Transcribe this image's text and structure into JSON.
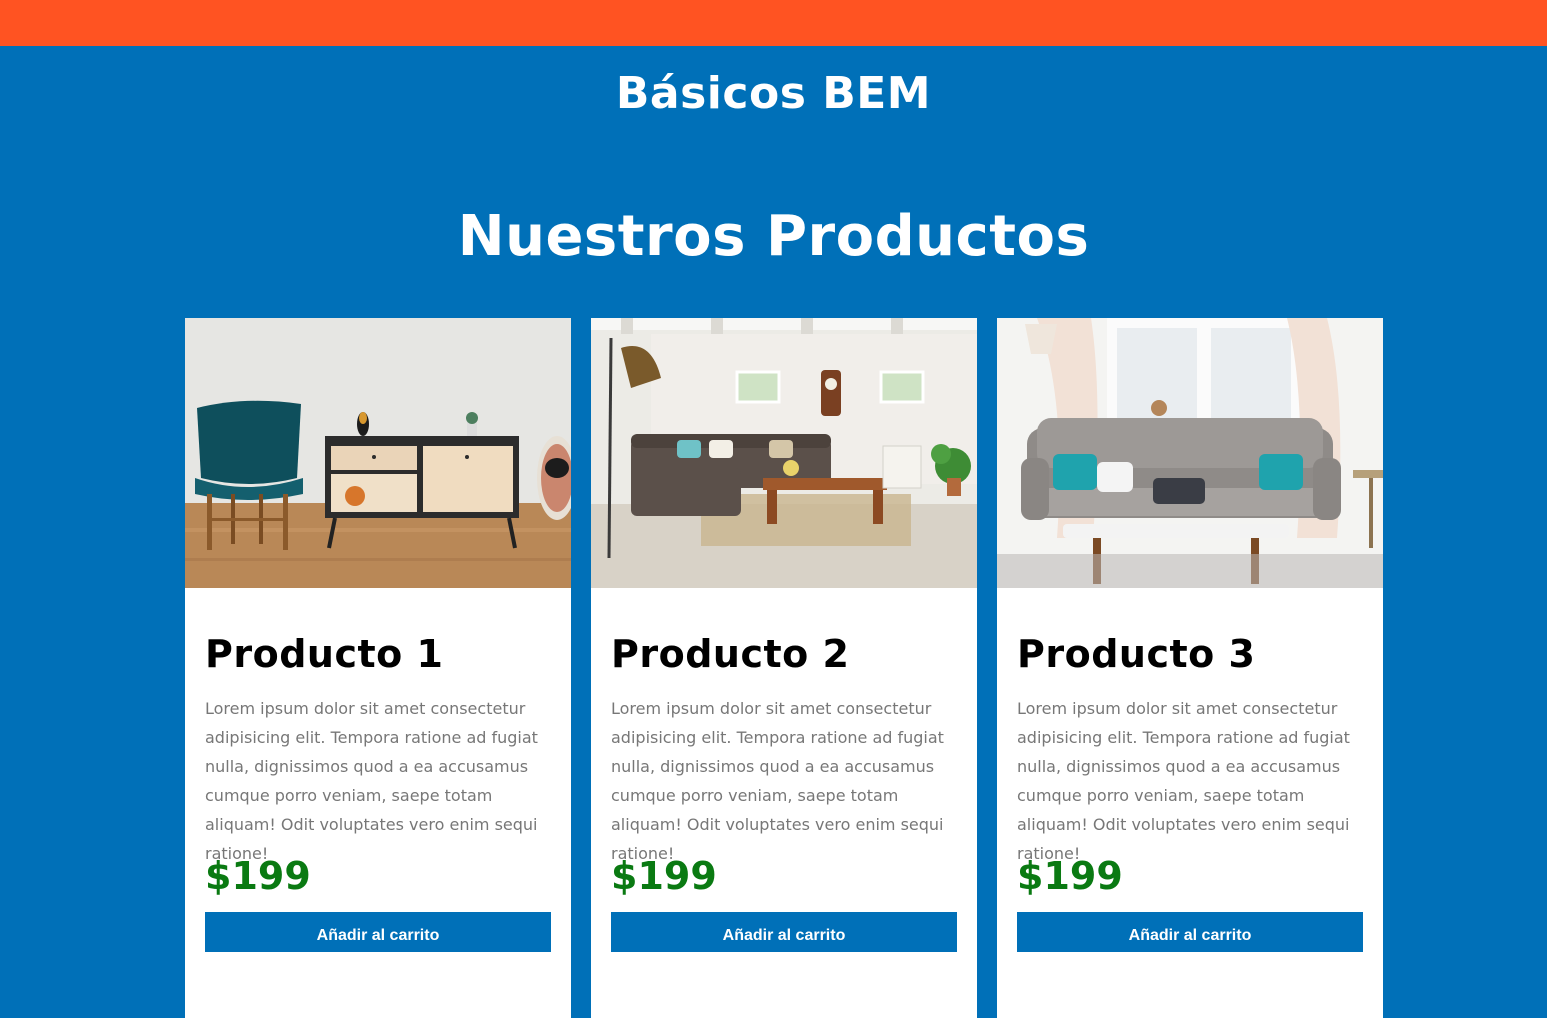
{
  "header": {
    "title": "Básicos BEM"
  },
  "section": {
    "title": "Nuestros Productos"
  },
  "colors": {
    "top_bar": "#ff5322",
    "background": "#0070b8",
    "price": "#0a7a12"
  },
  "products": [
    {
      "title": "Producto 1",
      "description": "Lorem ipsum dolor sit amet consectetur adipisicing elit. Tempora ratione ad fugiat nulla, dignissimos quod a ea accusamus cumque porro veniam, saepe totam aliquam! Odit voluptates vero enim sequi ratione!",
      "price": "$199",
      "button_label": "Añadir al carrito",
      "image_alt": "Sala con silla azul y mueble de madera"
    },
    {
      "title": "Producto 2",
      "description": "Lorem ipsum dolor sit amet consectetur adipisicing elit. Tempora ratione ad fugiat nulla, dignissimos quod a ea accusamus cumque porro veniam, saepe totam aliquam! Odit voluptates vero enim sequi ratione!",
      "price": "$199",
      "button_label": "Añadir al carrito",
      "image_alt": "Sala de estar con sofá esquinero y mesa de centro"
    },
    {
      "title": "Producto 3",
      "description": "Lorem ipsum dolor sit amet consectetur adipisicing elit. Tempora ratione ad fugiat nulla, dignissimos quod a ea accusamus cumque porro veniam, saepe totam aliquam! Odit voluptates vero enim sequi ratione!",
      "price": "$199",
      "button_label": "Añadir al carrito",
      "image_alt": "Sofá gris con cojines turquesa frente a una ventana"
    }
  ]
}
